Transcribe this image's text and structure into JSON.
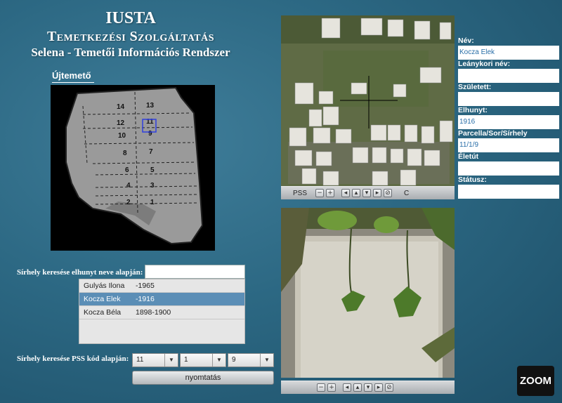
{
  "header": {
    "title": "IUSTA",
    "subtitle": "Temetkezési Szolgáltatás",
    "system": "Selena - Temetői Információs Rendszer"
  },
  "cemetery": {
    "name": "Újtemető",
    "parcels": [
      "14",
      "13",
      "12",
      "11",
      "10",
      "9",
      "8",
      "7",
      "6",
      "5",
      "4",
      "3",
      "2",
      "1"
    ]
  },
  "photo_toolbar": {
    "label": "PSS",
    "right_label": "C"
  },
  "details": {
    "name_label": "Név:",
    "name_value": "Kocza Elek",
    "maiden_label": "Leánykori név:",
    "maiden_value": "",
    "born_label": "Született:",
    "born_value": "",
    "died_label": "Elhunyt:",
    "died_value": "1916",
    "plot_label": "Parcella/Sor/Sírhely",
    "plot_value": "11/1/9",
    "bio_label": "Életút",
    "bio_value": "",
    "status_label": "Státusz:",
    "status_value": ""
  },
  "search_by_name": {
    "label": "Sírhely keresése elhunyt neve alapján:",
    "value": "",
    "results": [
      {
        "name": "Gulyás Ilona",
        "years": "-1965",
        "selected": false
      },
      {
        "name": "Kocza Elek",
        "years": "-1916",
        "selected": true
      },
      {
        "name": "Kocza Béla",
        "years": "1898-1900",
        "selected": false
      }
    ]
  },
  "search_by_pss": {
    "label": "Sírhely keresése  PSS kód alapján:",
    "parcel": "11",
    "row": "1",
    "grave": "9",
    "print_label": "nyomtatás"
  },
  "logo": {
    "text": "ZOOM"
  }
}
